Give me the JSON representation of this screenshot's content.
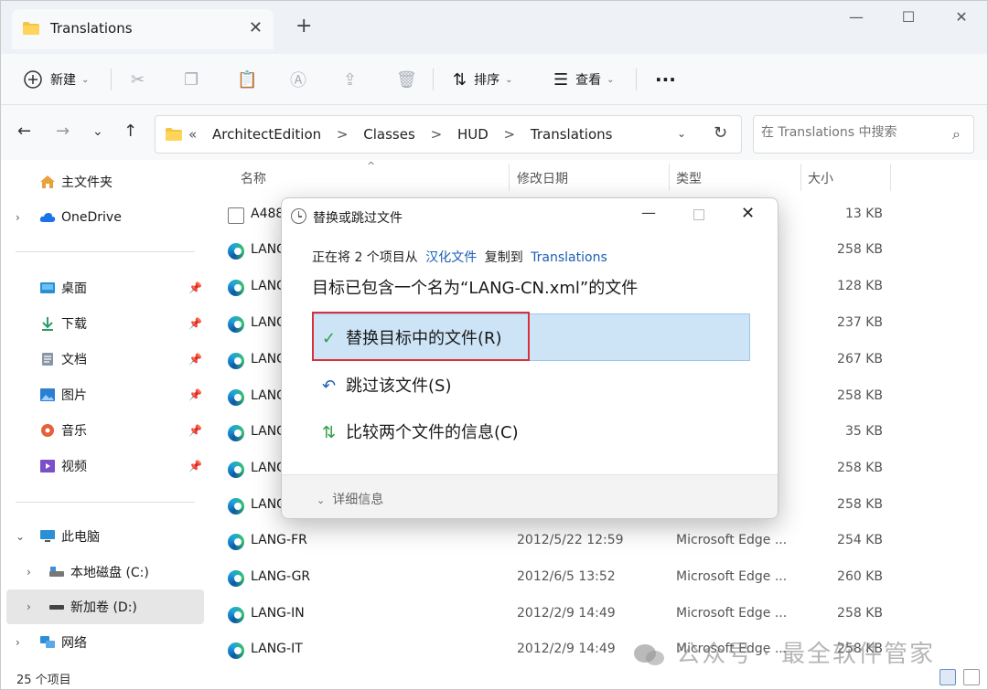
{
  "tab": {
    "title": "Translations"
  },
  "toolbar": {
    "new_label": "新建",
    "sort_label": "排序",
    "view_label": "查看",
    "more_label": "···"
  },
  "address": {
    "crumbs": [
      "«",
      "ArchitectEdition",
      ">",
      "Classes",
      ">",
      "HUD",
      ">",
      "Translations"
    ]
  },
  "search": {
    "placeholder": "在 Translations 中搜索"
  },
  "sidebar": {
    "items": [
      {
        "label": "主文件夹"
      },
      {
        "label": "OneDrive"
      },
      {
        "label": "桌面"
      },
      {
        "label": "下载"
      },
      {
        "label": "文档"
      },
      {
        "label": "图片"
      },
      {
        "label": "音乐"
      },
      {
        "label": "视频"
      },
      {
        "label": "此电脑"
      },
      {
        "label": "本地磁盘 (C:)"
      },
      {
        "label": "新加卷 (D:)"
      },
      {
        "label": "网络"
      }
    ]
  },
  "columns": {
    "name": "名称",
    "date": "修改日期",
    "type": "类型",
    "size": "大小"
  },
  "files": [
    {
      "name": "A488",
      "date": "",
      "type": "",
      "size": "13 KB",
      "icon": "document-icon"
    },
    {
      "name": "LANG",
      "date": "",
      "type": "",
      "size": "258 KB",
      "icon": "edge-icon"
    },
    {
      "name": "LANG",
      "date": "",
      "type": "",
      "size": "128 KB",
      "icon": "edge-icon"
    },
    {
      "name": "LANG",
      "date": "",
      "type": "",
      "size": "237 KB",
      "icon": "edge-icon"
    },
    {
      "name": "LANG",
      "date": "",
      "type": "",
      "size": "267 KB",
      "icon": "edge-icon"
    },
    {
      "name": "LANG",
      "date": "",
      "type": "",
      "size": "258 KB",
      "icon": "edge-icon"
    },
    {
      "name": "LANG",
      "date": "",
      "type": "",
      "size": "35 KB",
      "icon": "edge-icon"
    },
    {
      "name": "LANG",
      "date": "",
      "type": "",
      "size": "258 KB",
      "icon": "edge-icon"
    },
    {
      "name": "LANG",
      "date": "",
      "type": "",
      "size": "258 KB",
      "icon": "edge-icon"
    },
    {
      "name": "LANG-FR",
      "date": "2012/5/22 12:59",
      "type": "Microsoft Edge ...",
      "size": "254 KB",
      "icon": "edge-icon"
    },
    {
      "name": "LANG-GR",
      "date": "2012/6/5 13:52",
      "type": "Microsoft Edge ...",
      "size": "260 KB",
      "icon": "edge-icon"
    },
    {
      "name": "LANG-IN",
      "date": "2012/2/9 14:49",
      "type": "Microsoft Edge ...",
      "size": "258 KB",
      "icon": "edge-icon"
    },
    {
      "name": "LANG-IT",
      "date": "2012/2/9 14:49",
      "type": "Microsoft Edge ...",
      "size": "258 KB",
      "icon": "edge-icon"
    }
  ],
  "status": {
    "count": "25 个项目"
  },
  "watermark": {
    "text": "公众号 · 最全软件管家"
  },
  "dialog": {
    "title": "替换或跳过文件",
    "info_prefix": "正在将 2 个项目从",
    "info_source": "汉化文件",
    "info_mid": "复制到",
    "info_dest": "Translations",
    "headline": "目标已包含一个名为“LANG-CN.xml”的文件",
    "option_replace": "替换目标中的文件(R)",
    "option_skip": "跳过该文件(S)",
    "option_compare": "比较两个文件的信息(C)",
    "more_details": "详细信息"
  },
  "colors": {
    "accent": "#1a5fb4",
    "highlight": "#cde4f7",
    "red_box": "#d9303a",
    "check_green": "#2e9e49"
  }
}
